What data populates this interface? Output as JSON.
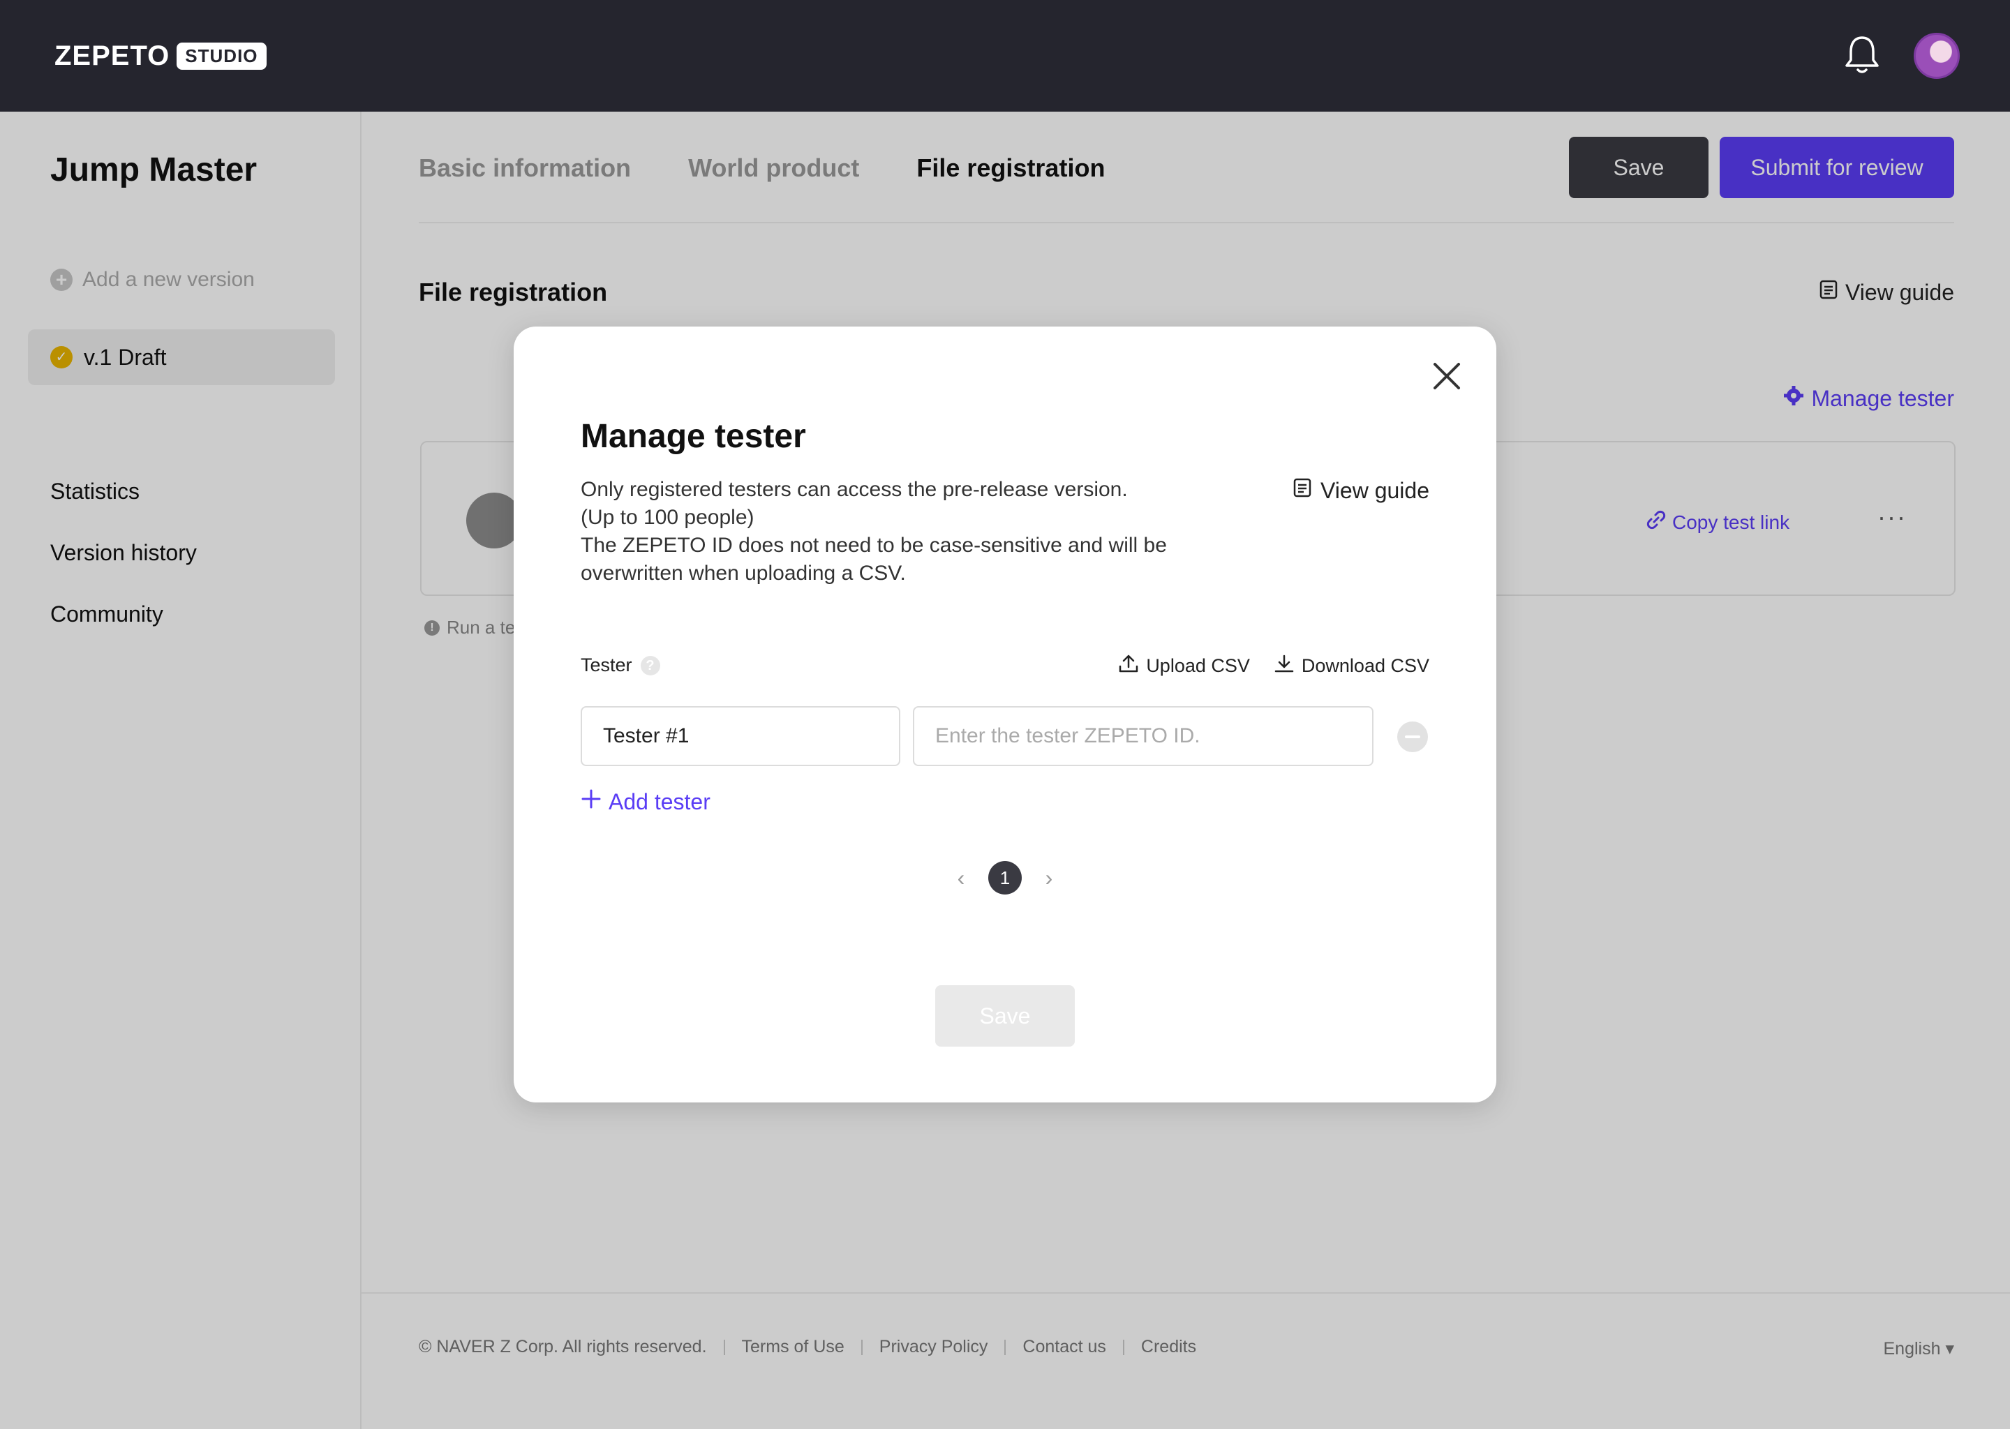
{
  "header": {
    "logo": "ZEPETO",
    "badge": "STUDIO",
    "icons": [
      "bell-icon",
      "avatar"
    ]
  },
  "sidebar": {
    "project_title": "Jump Master",
    "add_version": "Add a new version",
    "version": "v.1 Draft",
    "nav": [
      "Statistics",
      "Version history",
      "Community"
    ]
  },
  "main": {
    "tabs": [
      {
        "label": "Basic information",
        "active": false
      },
      {
        "label": "World product",
        "active": false
      },
      {
        "label": "File registration",
        "active": true
      }
    ],
    "save_label": "Save",
    "submit_label": "Submit for review",
    "section_title": "File registration",
    "view_guide": "View guide",
    "manage_tester": "Manage tester",
    "copy_test_link": "Copy test link",
    "more": "···",
    "run_note": "Run a te"
  },
  "footer": {
    "copyright": "© NAVER Z Corp. All rights reserved.",
    "links": [
      "Terms of Use",
      "Privacy Policy",
      "Contact us",
      "Credits"
    ],
    "language": "English"
  },
  "modal": {
    "title": "Manage tester",
    "description": [
      "Only registered testers can access the pre-release version.",
      "(Up to 100 people)",
      "The ZEPETO ID does not need to be case-sensitive and will be",
      "overwritten when uploading a CSV."
    ],
    "view_guide": "View guide",
    "tester_label": "Tester",
    "upload_csv": "Upload CSV",
    "download_csv": "Download CSV",
    "tester_name_value": "Tester #1",
    "tester_id_placeholder": "Enter the tester ZEPETO ID.",
    "add_tester": "Add tester",
    "current_page": "1",
    "save_label": "Save"
  },
  "colors": {
    "accent": "#5a3df5",
    "topbar": "#25252e",
    "draft_badge": "#e9b400"
  }
}
